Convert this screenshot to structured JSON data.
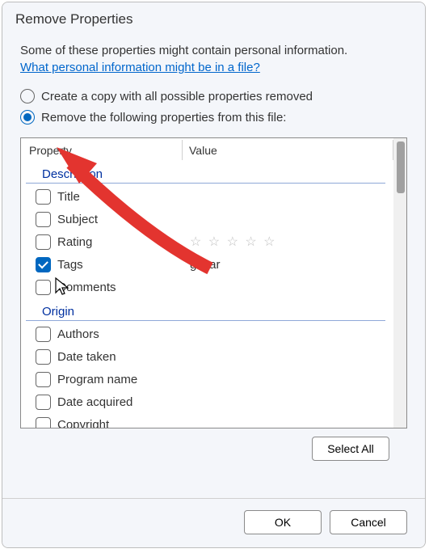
{
  "dialog": {
    "title": "Remove Properties",
    "intro": "Some of these properties might contain personal information.",
    "help_link": "What personal information might be in a file?",
    "radio1_label": "Create a copy with all possible properties removed",
    "radio2_label": "Remove the following properties from this file:",
    "selected_radio": 2
  },
  "list": {
    "header_property": "Property",
    "header_value": "Value",
    "groups": [
      {
        "name": "Description",
        "items": [
          {
            "label": "Title",
            "value": "",
            "checked": false
          },
          {
            "label": "Subject",
            "value": "",
            "checked": false
          },
          {
            "label": "Rating",
            "value": "stars",
            "checked": false
          },
          {
            "label": "Tags",
            "value": "guitar",
            "checked": true
          },
          {
            "label": "Comments",
            "value": "",
            "checked": false
          }
        ]
      },
      {
        "name": "Origin",
        "items": [
          {
            "label": "Authors",
            "value": "",
            "checked": false
          },
          {
            "label": "Date taken",
            "value": "",
            "checked": false
          },
          {
            "label": "Program name",
            "value": "",
            "checked": false
          },
          {
            "label": "Date acquired",
            "value": "",
            "checked": false
          },
          {
            "label": "Copyright",
            "value": "",
            "checked": false
          }
        ]
      }
    ]
  },
  "buttons": {
    "select_all": "Select All",
    "ok": "OK",
    "cancel": "Cancel"
  }
}
